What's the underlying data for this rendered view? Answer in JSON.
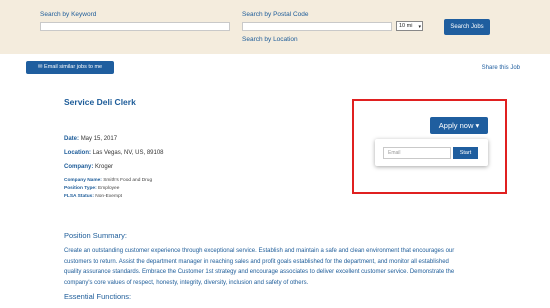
{
  "search": {
    "keyword_label": "Search by Keyword",
    "postal_label": "Search by Postal Code",
    "location_link": "Search by Location",
    "radius_value": "10 mi",
    "search_button": "Search Jobs"
  },
  "actions": {
    "email_similar": "Email similar jobs to me",
    "share": "Share this Job"
  },
  "job": {
    "title": "Service Deli Clerk",
    "date_label": "Date:",
    "date_value": "May 15, 2017",
    "location_label": "Location:",
    "location_value": "Las Vegas, NV, US, 89108",
    "company_label": "Company:",
    "company_value": "Kroger",
    "company_name_label": "Company Name:",
    "company_name_value": "Smith's Food and Drug",
    "position_type_label": "Position Type:",
    "position_type_value": "Employee",
    "flsa_label": "FLSA Status:",
    "flsa_value": "Non-Exempt"
  },
  "apply": {
    "button": "Apply now",
    "email_placeholder": "Email",
    "start_button": "Start"
  },
  "sections": {
    "summary_heading": "Position Summary:",
    "summary_lines": [
      "Create an outstanding customer experience through exceptional service. Establish and maintain a safe and clean environment that encourages our",
      "customers to return. Assist the department manager in reaching sales and profit goals established for the department, and monitor all established",
      "quality assurance standards. Embrace the Customer 1st strategy and encourage associates to deliver excellent customer service. Demonstrate the",
      "company's core values of respect, honesty, integrity, diversity, inclusion and safety of others."
    ],
    "functions_heading": "Essential Functions:"
  },
  "icons": {
    "email_button_icon": "envelope-icon",
    "apply_caret": "caret-down-icon",
    "select_caret": "chevron-down-icon"
  },
  "colors": {
    "brand_blue": "#1f5e9f",
    "search_bg": "#f4ecdd",
    "highlight_red": "#e02020"
  }
}
